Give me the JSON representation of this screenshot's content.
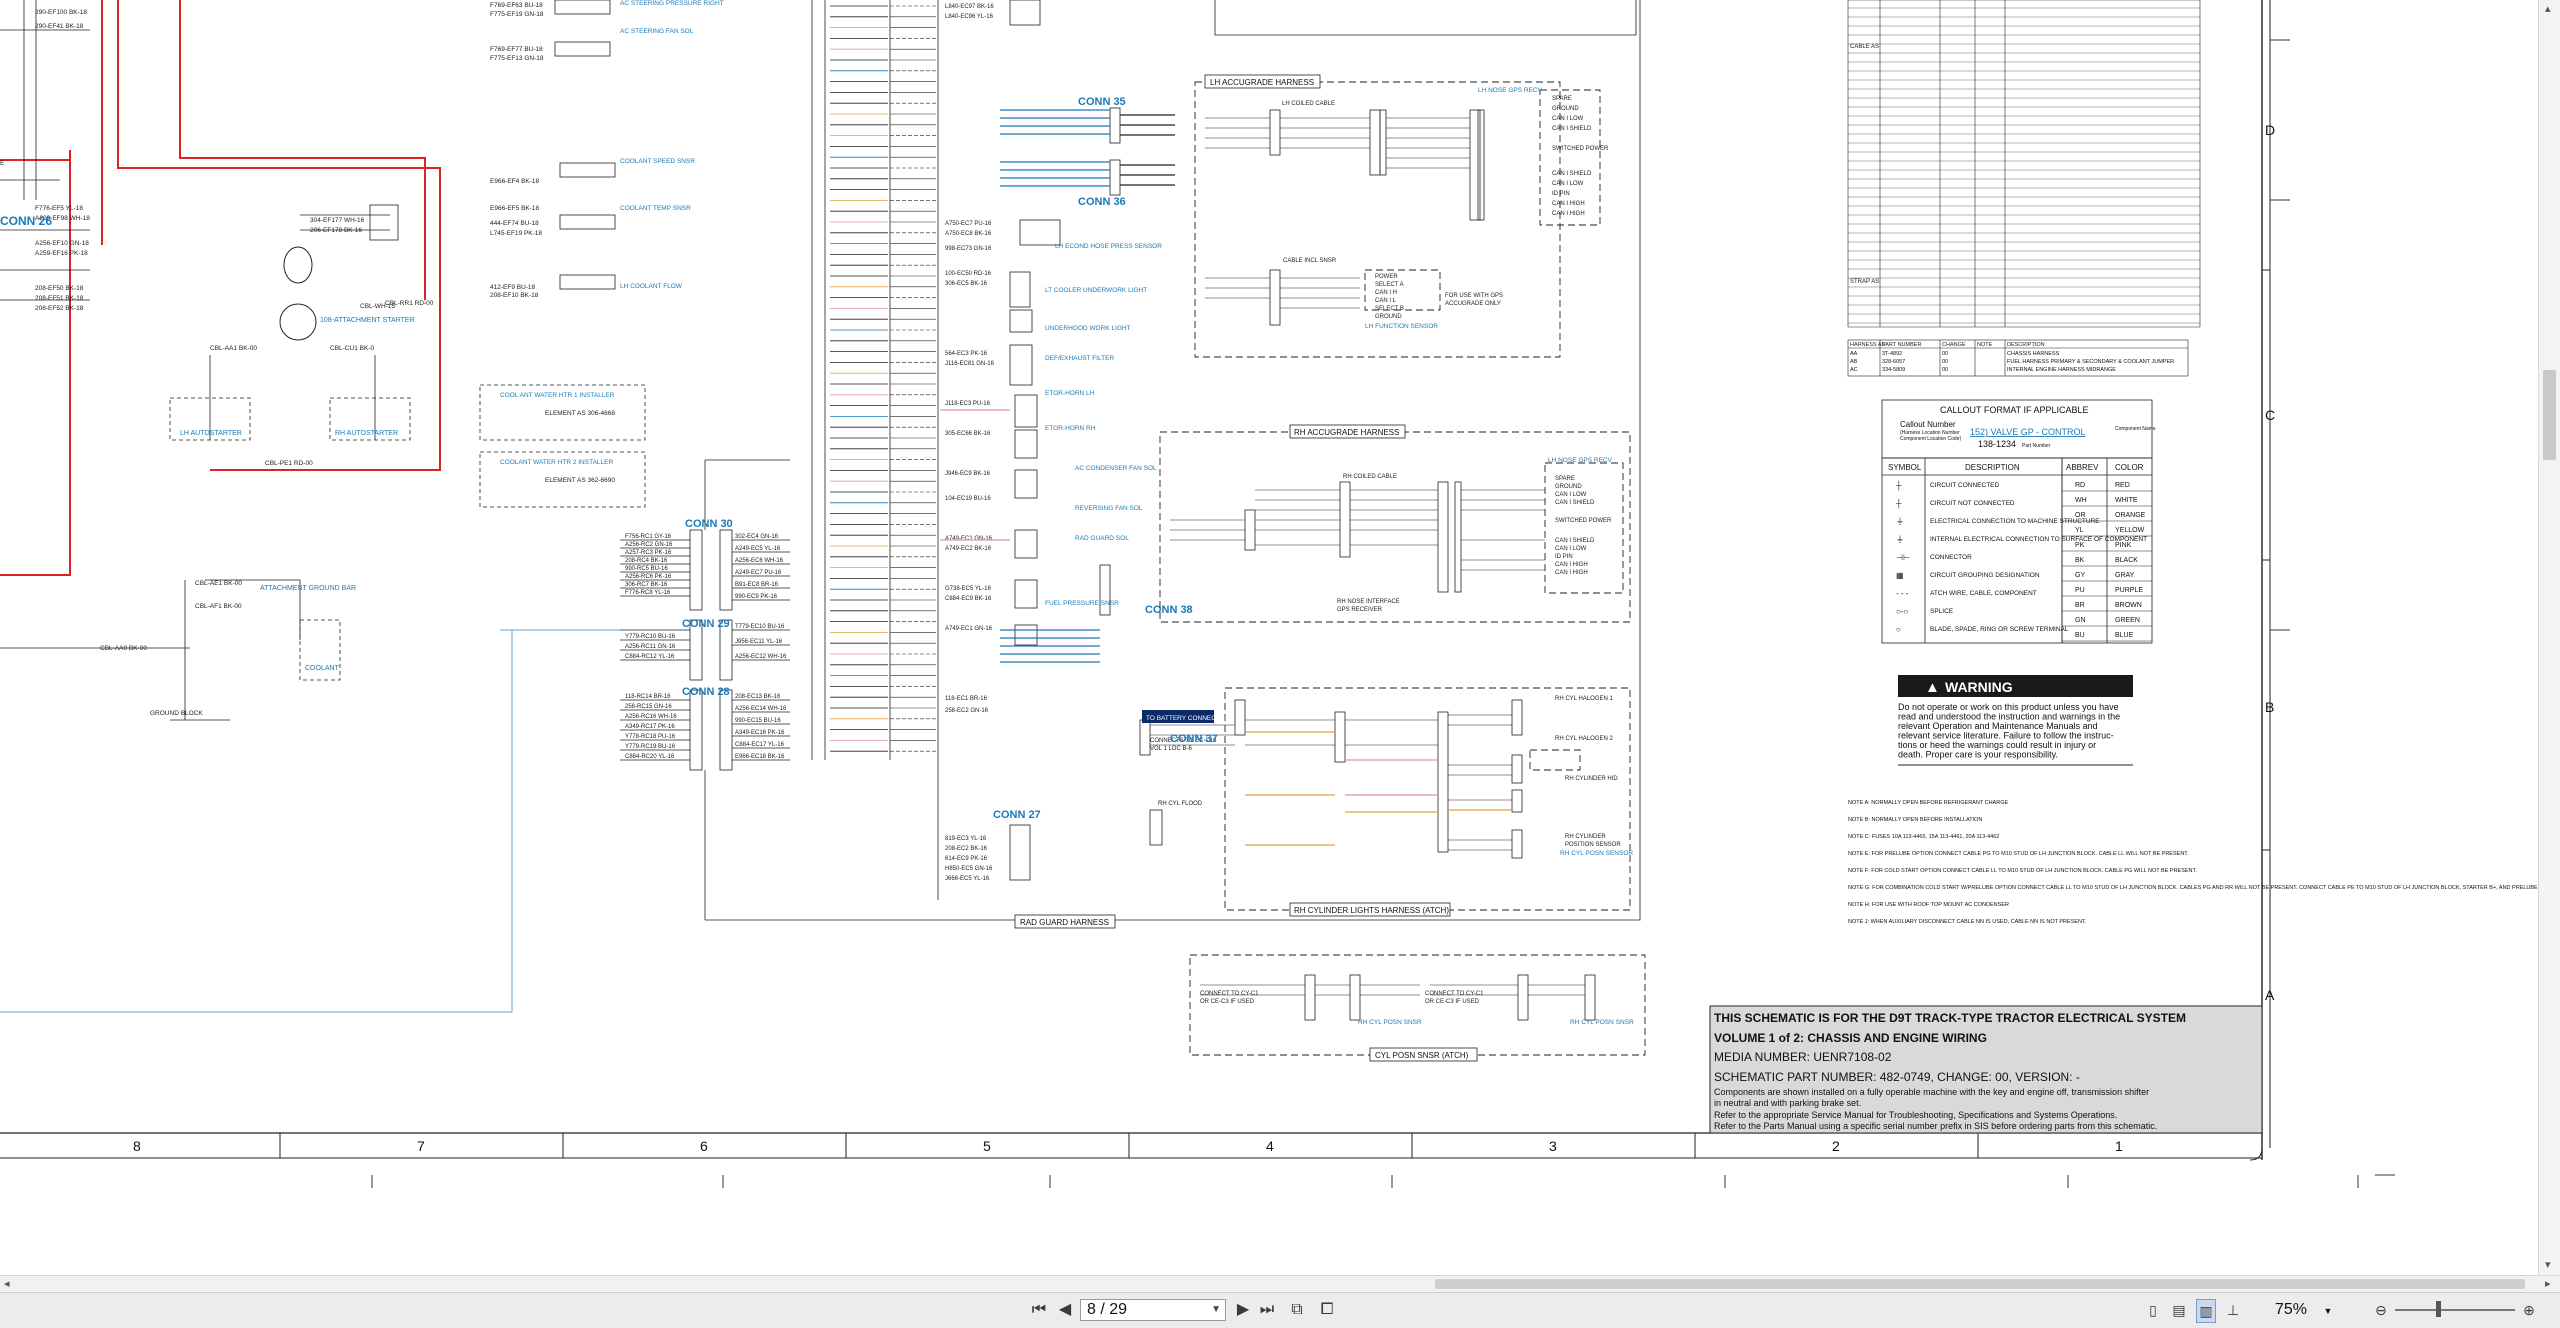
{
  "viewer": {
    "page_current": "8",
    "page_total": "29",
    "page_display": "8 / 29",
    "zoom": "75%",
    "zoom_minus": "−",
    "zoom_plus": "+",
    "icons": [
      "first-page-icon",
      "prev-page-icon",
      "next-page-icon",
      "last-page-icon",
      "view-single-icon",
      "view-continuous-icon",
      "view-facing-icon",
      "view-book-icon",
      "fit-width-icon",
      "fit-page-icon",
      "zoom-out-icon",
      "zoom-in-icon"
    ]
  },
  "title_block": {
    "line1": "THIS SCHEMATIC IS FOR THE D9T TRACK-TYPE TRACTOR ELECTRICAL SYSTEM",
    "line2": "VOLUME 1 of 2: CHASSIS AND ENGINE WIRING",
    "line3": "MEDIA NUMBER: UENR7108-02",
    "line4": "SCHEMATIC PART NUMBER: 482-0749, CHANGE: 00, VERSION: -",
    "line5": "Components are shown installed on a fully operable machine with the key and engine off, transmission shifter",
    "line6": "in neutral and with parking brake set.",
    "line7": "Refer to the appropriate Service Manual for Troubleshooting, Specifications and Systems Operations.",
    "line8": "Refer to the Parts Manual using a specific serial number prefix in SIS before ordering parts from this schematic."
  },
  "warning": {
    "header": "WARNING",
    "lines": [
      "Do not operate or work on this product unless you have",
      "read and understood the instruction and warnings in the",
      "relevant Operation and Maintenance Manuals and",
      "relevant service literature. Failure to follow the instruc-",
      "tions or heed the warnings could result in injury or",
      "death. Proper care is your responsibility."
    ]
  },
  "callout": {
    "title": "CALLOUT FORMAT IF APPLICABLE",
    "left_label": "Callout Number",
    "left_sub1": "(Harness Location Number",
    "left_sub2": "Component Location Code)",
    "sample": "152) VALVE GP - CONTROL",
    "sample_pn": "138-1234",
    "comp_label": "Component Name",
    "pn_label": "Part Number"
  },
  "legend": {
    "headers": [
      "SYMBOL",
      "DESCRIPTION",
      "ABBREV",
      "COLOR"
    ],
    "descriptions": [
      "CIRCUIT CONNECTED",
      "CIRCUIT NOT CONNECTED",
      "ELECTRICAL CONNECTION TO MACHINE STRUCTURE",
      "INTERNAL ELECTRICAL CONNECTION TO SURFACE OF COMPONENT",
      "CONNECTOR",
      "CIRCUIT GROUPING DESIGNATION",
      "ATCH WIRE, CABLE, COMPONENT",
      "SPLICE",
      "BLADE, SPADE, RING OR SCREW TERMINAL"
    ],
    "abbrevs": [
      "RD",
      "WH",
      "OR",
      "YL",
      "PK",
      "BK",
      "GY",
      "PU",
      "BR",
      "GN",
      "BU"
    ],
    "colors": [
      "RED",
      "WHITE",
      "ORANGE",
      "YELLOW",
      "PINK",
      "BLACK",
      "GRAY",
      "PURPLE",
      "BROWN",
      "GREEN",
      "BLUE"
    ]
  },
  "grid": {
    "columns": [
      "8",
      "7",
      "6",
      "5",
      "4",
      "3",
      "2",
      "1"
    ],
    "rows": [
      "D",
      "C",
      "B",
      "A"
    ]
  },
  "harness_labels": {
    "lh_accugrade": "LH ACCUGRADE HARNESS",
    "rh_accugrade": "RH ACCUGRADE HARNESS",
    "rad_guard": "RAD GUARD HARNESS",
    "rh_cylinder": "RH CYLINDER LIGHTS HARNESS (ATCH)",
    "cyl_posn": "CYL POSN SNSR (ATCH)"
  },
  "connector_labels": {
    "conn26": "CONN 26",
    "conn28": "CONN 28",
    "conn29": "CONN 29",
    "conn30": "CONN 30",
    "conn35": "CONN 35",
    "conn36": "CONN 36",
    "conn37": "CONN 37",
    "conn38": "CONN 38",
    "conn27": "CONN 27"
  },
  "notes": [
    "NOTE A: NORMALLY OPEN BEFORE REFRIGERANT CHARGE",
    "NOTE B: NORMALLY OPEN BEFORE INSTALLATION",
    "NOTE C: FUSES 10A 113-4465, 15A 113-4461, 20A 113-4462",
    "NOTE E: FOR PRELUBE OPTION CONNECT CABLE PG TO M10 STUD OF LH JUNCTION BLOCK. CABLE LL WILL NOT BE PRESENT.",
    "NOTE F: FOR COLD START OPTION CONNECT CABLE LL TO M10 STUD OF LH JUNCTION BLOCK. CABLE PG WILL NOT BE PRESENT.",
    "NOTE G: FOR COMBINATION COLD START W/PRELUBE OPTION CONNECT CABLE LL TO M10 STUD OF LH JUNCTION BLOCK. CABLES PG AND RR WILL NOT BE PRESENT. CONNECT CABLE PE TO M10 STUD OF LH JUNCTION BLOCK, STARTER B+, AND PRELUBE POWER.",
    "NOTE H: FOR USE WITH ROOF TOP MOUNT AC CONDENSER",
    "NOTE J: WHEN AUXILIARY DISCONNECT CABLE NN IS USED, CABLE NN IS NOT PRESENT."
  ],
  "harness_table_rows": [
    [
      "AA",
      "3T-4892",
      "00",
      "",
      "CHASSIS HARNESS"
    ],
    [
      "AB",
      "328-6057",
      "00",
      "",
      "FUEL HARNESS PRIMARY & SECONDARY & COOLANT JUMPER"
    ],
    [
      "AC",
      "334-5809",
      "00",
      "",
      "INTERNAL ENGINE HARNESS MIDRANGE"
    ]
  ],
  "misc": {
    "to_battery": "TO BATTERY CONNECTOR"
  }
}
